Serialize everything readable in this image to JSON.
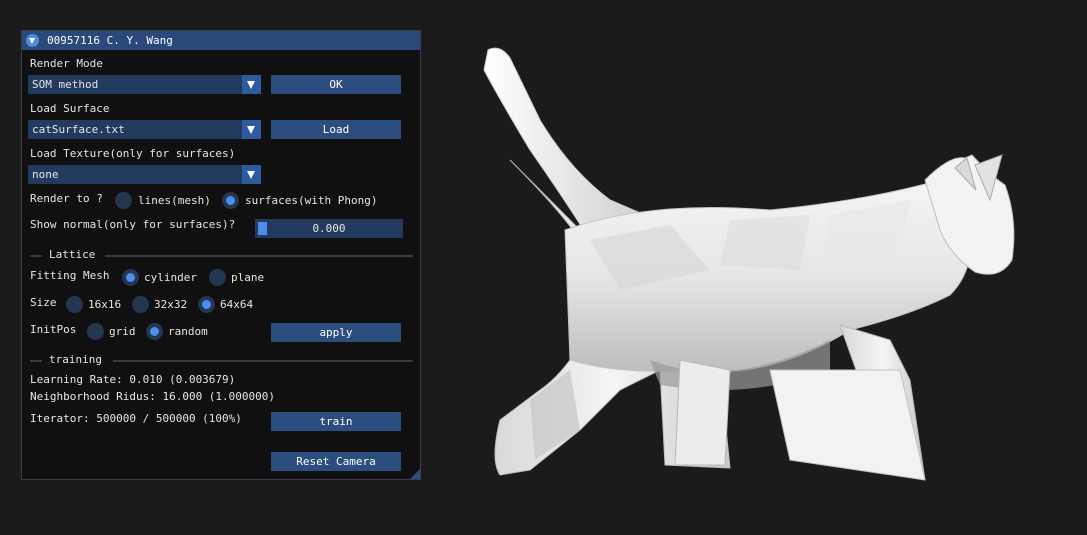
{
  "window": {
    "title": "00957116 C. Y. Wang"
  },
  "render_mode": {
    "label": "Render Mode",
    "value": "SOM method",
    "ok_label": "OK"
  },
  "load_surface": {
    "label": "Load Surface",
    "value": "catSurface.txt",
    "load_label": "Load"
  },
  "load_texture": {
    "label": "Load Texture(only for surfaces)",
    "value": "none"
  },
  "render_to": {
    "label": "Render to ?",
    "options": [
      "lines(mesh)",
      "surfaces(with Phong)"
    ],
    "selected": "surfaces(with Phong)"
  },
  "show_normal": {
    "label": "Show normal(only for surfaces)?",
    "value": "0.000",
    "fraction": 0.0
  },
  "lattice": {
    "header": "Lattice",
    "fitting_mesh": {
      "label": "Fitting Mesh",
      "options": [
        "cylinder",
        "plane"
      ],
      "selected": "cylinder"
    },
    "size": {
      "label": "Size",
      "options": [
        "16x16",
        "32x32",
        "64x64"
      ],
      "selected": "64x64"
    },
    "init_pos": {
      "label": "InitPos",
      "options": [
        "grid",
        "random"
      ],
      "selected": "random"
    },
    "apply_label": "apply"
  },
  "training": {
    "header": "training",
    "learning_rate": "Learning Rate: 0.010 (0.003679)",
    "neighborhood": "Neighborhood Ridus: 16.000 (1.000000)",
    "iterator": "Iterator: 500000 / 500000 (100%)",
    "train_label": "train"
  },
  "reset_camera_label": "Reset Camera",
  "colors": {
    "background": "#1b1b1b",
    "panel": "#101010",
    "titlebar": "#29497a",
    "accent": "#4a8ff0",
    "button": "#2c4e7e",
    "frame": "#223a5e"
  },
  "viewport": {
    "model": "cat surface",
    "shading": "phong"
  }
}
